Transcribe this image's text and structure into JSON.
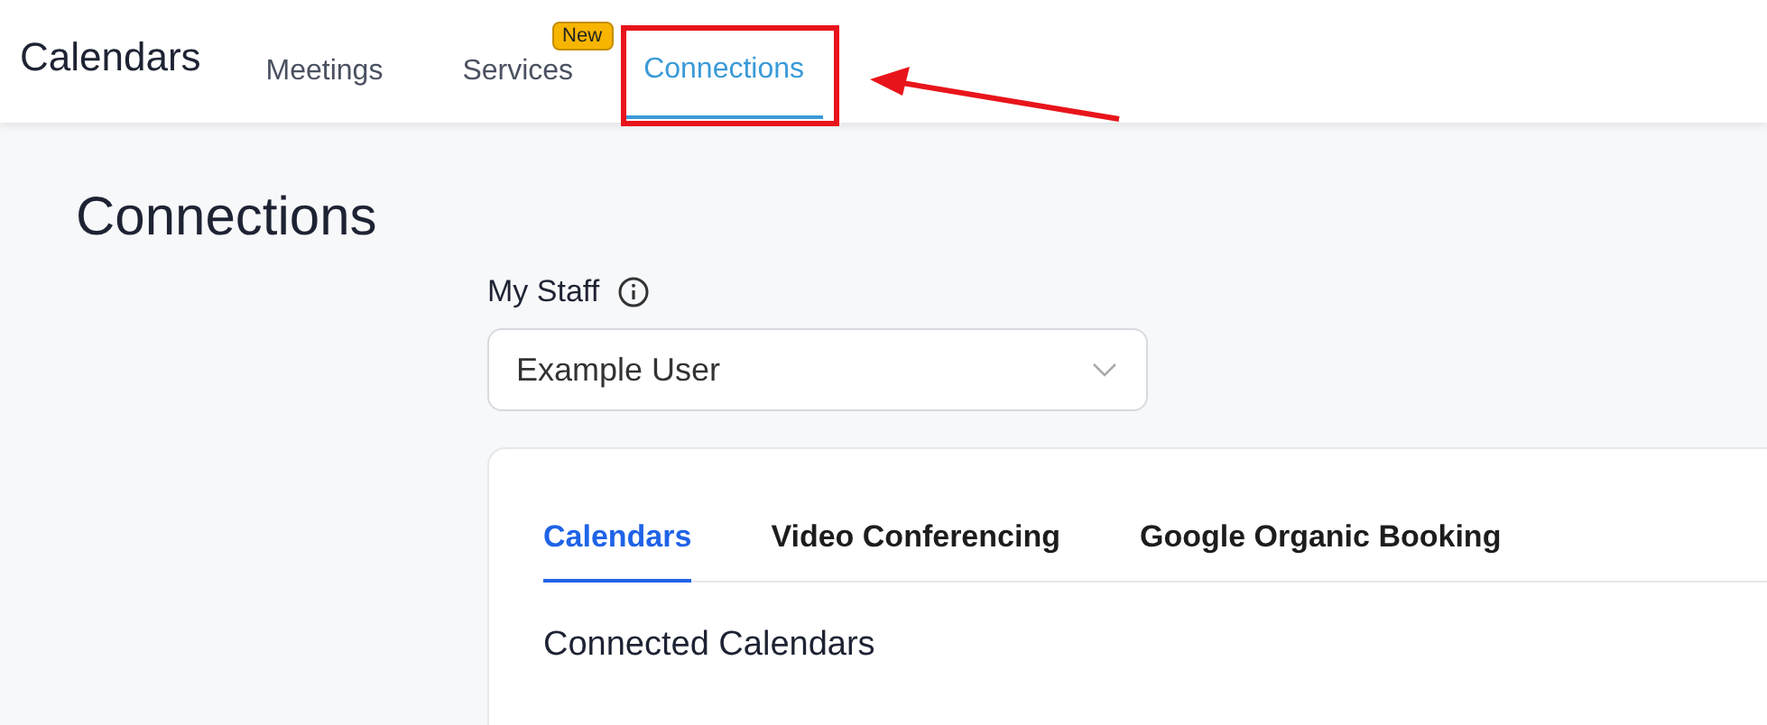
{
  "app_title": "Calendars",
  "nav_tabs": [
    {
      "label": "Meetings",
      "selected": false,
      "highlighted": false
    },
    {
      "label": "Services",
      "selected": false,
      "highlighted": false,
      "badge": "New"
    },
    {
      "label": "Connections",
      "selected": true,
      "highlighted": true
    }
  ],
  "page_title": "Connections",
  "staff": {
    "label": "My Staff",
    "value": "Example User"
  },
  "card": {
    "tabs": [
      {
        "label": "Calendars",
        "selected": true
      },
      {
        "label": "Video Conferencing",
        "selected": false
      },
      {
        "label": "Google Organic Booking",
        "selected": false
      }
    ],
    "section_title": "Connected Calendars"
  }
}
